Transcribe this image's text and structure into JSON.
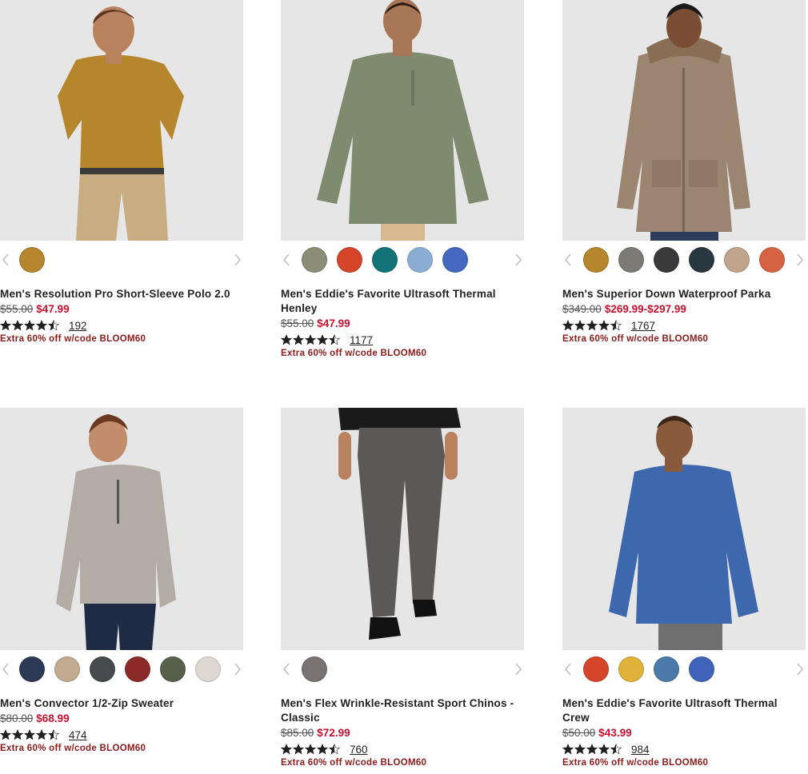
{
  "products": [
    {
      "name": "Men's Resolution Pro Short-Sleeve Polo 2.0",
      "original_price": "$55.00",
      "sale_price": "$47.99",
      "rating": 4.5,
      "review_count": "192",
      "promo": "Extra 60% off w/code BLOOM60",
      "swatches": [
        "#b5862c"
      ],
      "image_subject": "polo"
    },
    {
      "name": "Men's Eddie's Favorite Ultrasoft Thermal Henley",
      "original_price": "$55.00",
      "sale_price": "$47.99",
      "rating": 4.5,
      "review_count": "1177",
      "promo": "Extra 60% off w/code BLOOM60",
      "swatches": [
        "#8b8d76",
        "#d5452a",
        "#127378",
        "#8aaed3",
        "#4568bf"
      ],
      "image_subject": "henley"
    },
    {
      "name": "Men's Superior Down Waterproof Parka",
      "original_price": "$349.00",
      "sale_price": "$269.99-$297.99",
      "rating": 4.5,
      "review_count": "1767",
      "promo": "Extra 60% off w/code BLOOM60",
      "swatches": [
        "#b5862c",
        "#7b7a74",
        "#3a3a3a",
        "#283740",
        "#c0a48c",
        "#d66244"
      ],
      "image_subject": "parka"
    },
    {
      "name": "Men's Convector 1/2-Zip Sweater",
      "original_price": "$80.00",
      "sale_price": "$68.99",
      "rating": 4.5,
      "review_count": "474",
      "promo": "Extra 60% off w/code BLOOM60",
      "swatches": [
        "#2d3a55",
        "#c2ab90",
        "#474b4b",
        "#8b2a28",
        "#56604a",
        "#ddd8d2"
      ],
      "image_subject": "sweater"
    },
    {
      "name": "Men's Flex Wrinkle-Resistant Sport Chinos - Classic",
      "original_price": "$85.00",
      "sale_price": "$72.99",
      "rating": 4.5,
      "review_count": "760",
      "promo": "Extra 60% off w/code BLOOM60",
      "swatches": [
        "#787272"
      ],
      "image_subject": "chinos"
    },
    {
      "name": "Men's Eddie's Favorite Ultrasoft Thermal Crew",
      "original_price": "$50.00",
      "sale_price": "$43.99",
      "rating": 4.5,
      "review_count": "984",
      "promo": "Extra 60% off w/code BLOOM60",
      "swatches": [
        "#d5452a",
        "#e0b23a",
        "#4b7aa8",
        "#3f63b8"
      ],
      "image_subject": "crew"
    }
  ],
  "colors": {
    "sale": "#c8102e",
    "promo": "#8b1a1a",
    "image_bg": "#e6e6e6",
    "arrow": "#bdbdbd",
    "star": "#231f20"
  }
}
